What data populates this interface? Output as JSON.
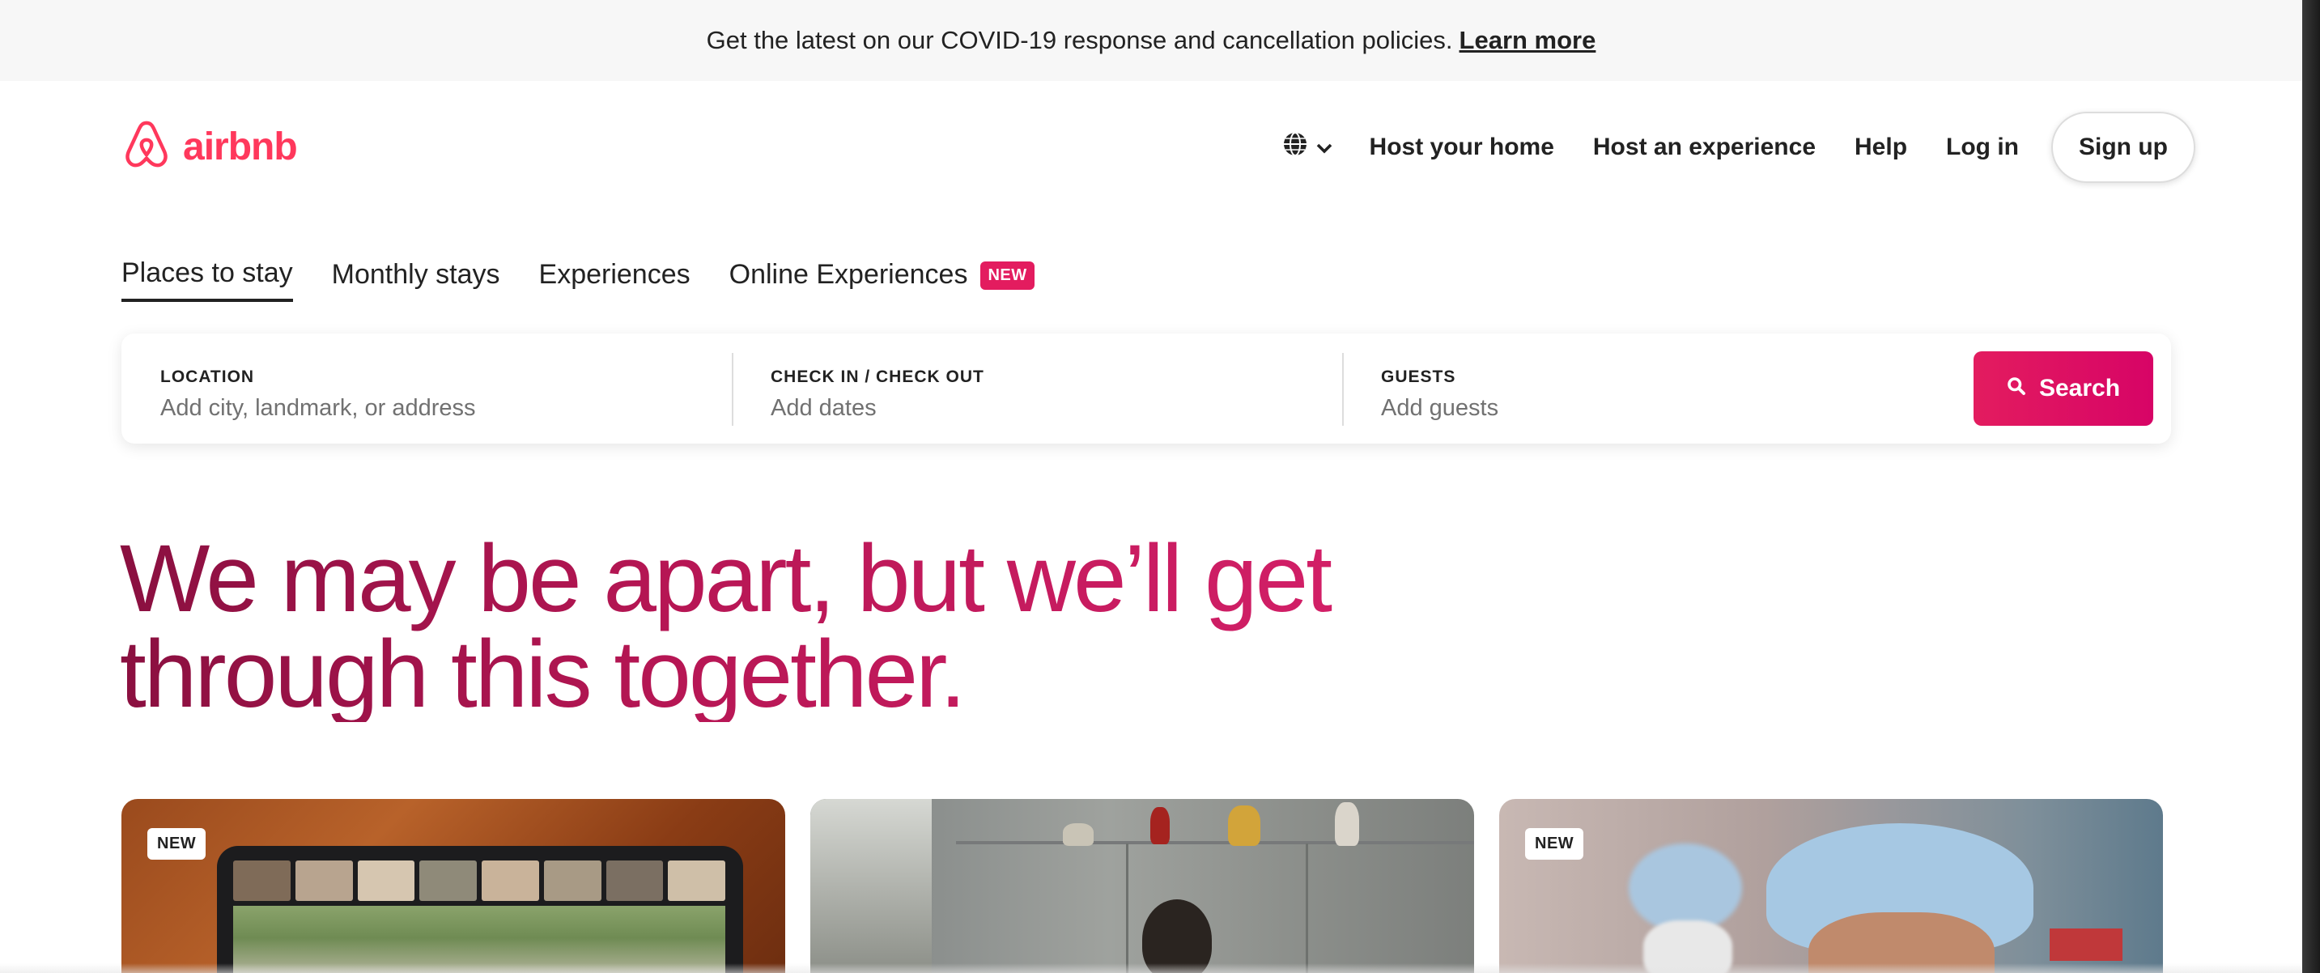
{
  "banner": {
    "text": "Get the latest on our COVID-19 response and cancellation policies.",
    "link": "Learn more"
  },
  "header": {
    "logo_text": "airbnb",
    "nav": {
      "host_home": "Host your home",
      "host_experience": "Host an experience",
      "help": "Help",
      "login": "Log in",
      "signup": "Sign up"
    }
  },
  "tabs": [
    {
      "label": "Places to stay",
      "active": true
    },
    {
      "label": "Monthly stays"
    },
    {
      "label": "Experiences"
    },
    {
      "label": "Online Experiences",
      "badge": "NEW"
    }
  ],
  "search": {
    "location": {
      "label": "LOCATION",
      "placeholder": "Add city, landmark, or address"
    },
    "dates": {
      "label": "CHECK IN / CHECK OUT",
      "placeholder": "Add dates"
    },
    "guests": {
      "label": "GUESTS",
      "placeholder": "Add guests"
    },
    "button": "Search"
  },
  "headline": {
    "line1": "We may be apart, but we’ll get",
    "line2": "through this together."
  },
  "cards": [
    {
      "badge": "NEW",
      "image": "video-call-tablet"
    },
    {
      "image": "person-at-home"
    },
    {
      "badge": "NEW",
      "image": "healthcare-workers"
    }
  ],
  "colors": {
    "brand": "#ff385c",
    "search_button": "#e31c5f",
    "headline": "#b0175a"
  }
}
